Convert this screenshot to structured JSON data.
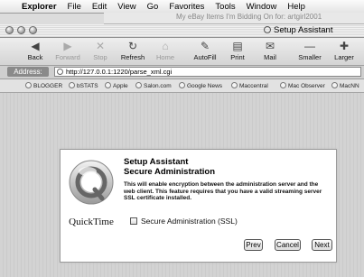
{
  "menubar": {
    "apple": "",
    "items": [
      "Explorer",
      "File",
      "Edit",
      "View",
      "Go",
      "Favorites",
      "Tools",
      "Window",
      "Help"
    ]
  },
  "background_window": {
    "title": "My eBay Items I'm Bidding On for: artgirl2001"
  },
  "window": {
    "title": "Setup Assistant"
  },
  "toolbar": {
    "back": "Back",
    "forward": "Forward",
    "stop": "Stop",
    "refresh": "Refresh",
    "home": "Home",
    "autofill": "AutoFill",
    "print": "Print",
    "mail": "Mail",
    "smaller": "Smaller",
    "larger": "Larger"
  },
  "address": {
    "label": "Address:",
    "url": "http://127.0.0.1:1220/parse_xml.cgi"
  },
  "favorites": [
    "BLOGGER",
    "bSTATS",
    "Apple",
    "Salon.com",
    "Google News",
    "Maccentral",
    "Mac Observer",
    "MacNN"
  ],
  "dialog": {
    "logo_text": "QuickTime",
    "title_line1": "Setup Assistant",
    "title_line2": "Secure Administration",
    "body": "This will enable encryption between the administration server and the web client. This feature requires that you have a valid streaming server SSL certificate installed.",
    "checkbox_label": "Secure Administration (SSL)",
    "checkbox_checked": false,
    "prev": "Prev",
    "cancel": "Cancel",
    "next": "Next"
  }
}
